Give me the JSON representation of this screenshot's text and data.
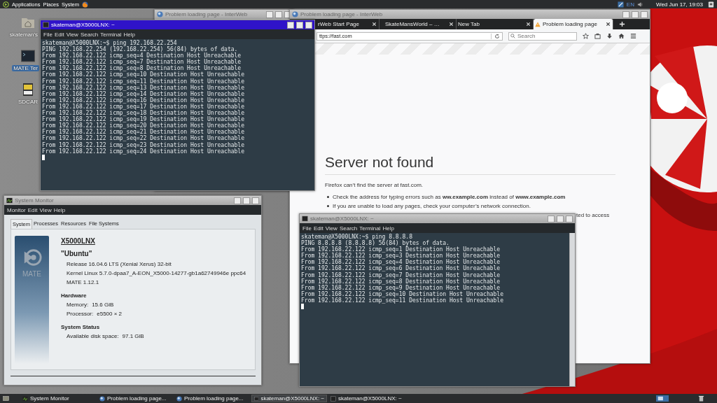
{
  "top_panel": {
    "menus": [
      "Applications",
      "Places",
      "System"
    ],
    "keyboard_layout": "EN",
    "clock": "Wed Jun 17, 19:03"
  },
  "desktop_icons": [
    {
      "kind": "folder",
      "label": "skateman's",
      "selected": false
    },
    {
      "kind": "terminal",
      "label": "MATE Ter",
      "selected": true
    },
    {
      "kind": "card",
      "label": "SDCAR",
      "selected": false
    }
  ],
  "background_browser": {
    "title": "Problem loading page - InterWeb"
  },
  "browser": {
    "title": "Problem loading page - InterWeb",
    "tabs": [
      {
        "label": "rWeb Start Page",
        "selected": false,
        "warning": false
      },
      {
        "label": "SkateMansWorld – …",
        "selected": false,
        "warning": false
      },
      {
        "label": "New Tab",
        "selected": false,
        "warning": false
      },
      {
        "label": "Problem loading page",
        "selected": true,
        "warning": true
      }
    ],
    "url": "ttps://fast.com",
    "search": {
      "placeholder": "Search"
    },
    "error": {
      "heading": "Server not found",
      "message": "Firefox can’t find the server at fast.com.",
      "bullets": [
        "Check the address for typing errors such as **ww.example.com** instead of **www.example.com**",
        "If you are unable to load any pages, check your computer’s network connection."
      ],
      "covered_line_end": "ted to access"
    }
  },
  "terminals": [
    {
      "title": "skateman@X5000LNX: ~",
      "active": true,
      "menus": [
        "File",
        "Edit",
        "View",
        "Search",
        "Terminal",
        "Help"
      ],
      "lines": [
        "skateman@X5000LNX:~$ ping 192.168.22.254",
        "PING 192.168.22.254 (192.168.22.254) 56(84) bytes of data.",
        "From 192.168.22.122 icmp_seq=4 Destination Host Unreachable",
        "From 192.168.22.122 icmp_seq=7 Destination Host Unreachable",
        "From 192.168.22.122 icmp_seq=8 Destination Host Unreachable",
        "From 192.168.22.122 icmp_seq=10 Destination Host Unreachable",
        "From 192.168.22.122 icmp_seq=11 Destination Host Unreachable",
        "From 192.168.22.122 icmp_seq=13 Destination Host Unreachable",
        "From 192.168.22.122 icmp_seq=14 Destination Host Unreachable",
        "From 192.168.22.122 icmp_seq=16 Destination Host Unreachable",
        "From 192.168.22.122 icmp_seq=17 Destination Host Unreachable",
        "From 192.168.22.122 icmp_seq=18 Destination Host Unreachable",
        "From 192.168.22.122 icmp_seq=19 Destination Host Unreachable",
        "From 192.168.22.122 icmp_seq=20 Destination Host Unreachable",
        "From 192.168.22.122 icmp_seq=21 Destination Host Unreachable",
        "From 192.168.22.122 icmp_seq=22 Destination Host Unreachable",
        "From 192.168.22.122 icmp_seq=23 Destination Host Unreachable",
        "From 192.168.22.122 icmp_seq=24 Destination Host Unreachable"
      ]
    },
    {
      "title": "skateman@X5000LNX: ~",
      "active": false,
      "menus": [
        "File",
        "Edit",
        "View",
        "Search",
        "Terminal",
        "Help"
      ],
      "lines": [
        "skateman@X5000LNX:~$ ping 8.8.8.8",
        "PING 8.8.8.8 (8.8.8.8) 56(84) bytes of data.",
        "From 192.168.22.122 icmp_seq=1 Destination Host Unreachable",
        "From 192.168.22.122 icmp_seq=3 Destination Host Unreachable",
        "From 192.168.22.122 icmp_seq=4 Destination Host Unreachable",
        "From 192.168.22.122 icmp_seq=6 Destination Host Unreachable",
        "From 192.168.22.122 icmp_seq=7 Destination Host Unreachable",
        "From 192.168.22.122 icmp_seq=8 Destination Host Unreachable",
        "From 192.168.22.122 icmp_seq=9 Destination Host Unreachable",
        "From 192.168.22.122 icmp_seq=10 Destination Host Unreachable",
        "From 192.168.22.122 icmp_seq=11 Destination Host Unreachable"
      ]
    }
  ],
  "system_monitor": {
    "title": "System Monitor",
    "menus": [
      "Monitor",
      "Edit",
      "View",
      "Help"
    ],
    "tabs": [
      {
        "label": "System",
        "selected": true
      },
      {
        "label": "Processes",
        "selected": false
      },
      {
        "label": "Resources",
        "selected": false
      },
      {
        "label": "File Systems",
        "selected": false
      }
    ],
    "logo_text": "MATE",
    "hostname": "X5000LNX",
    "distro": "\"Ubuntu\"",
    "details": [
      "Release 16.04.6 LTS (Xenial Xerus) 32-bit",
      "Kernel Linux 5.7.0-dpaa7_A-EON_X5000-14277-gb1a62749946e ppc64",
      "MATE 1.12.1"
    ],
    "sections": [
      {
        "heading": "Hardware",
        "rows": [
          {
            "label": "Memory:",
            "value": "15.6 GiB"
          },
          {
            "label": "Processor:",
            "value": "e5500 × 2"
          }
        ]
      },
      {
        "heading": "System Status",
        "rows": [
          {
            "label": "Available disk space:",
            "value": "97.1 GiB"
          }
        ]
      }
    ]
  },
  "taskbar": {
    "items": [
      {
        "kind": "monitor",
        "label": "System Monitor",
        "selected": false
      },
      {
        "kind": "browser",
        "label": "Problem loading page...",
        "selected": false
      },
      {
        "kind": "browser",
        "label": "Problem loading page...",
        "selected": false
      },
      {
        "kind": "terminal",
        "label": "skateman@X5000LNX: ~",
        "selected": true
      },
      {
        "kind": "terminal",
        "label": "skateman@X5000LNX: ~",
        "selected": false
      }
    ]
  }
}
